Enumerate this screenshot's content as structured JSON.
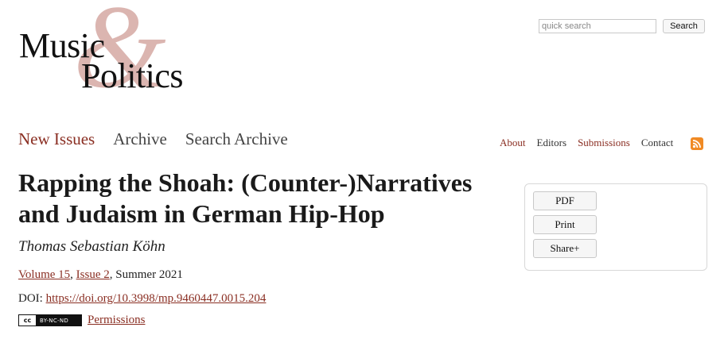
{
  "logo": {
    "word1": "Music",
    "ampersand": "&",
    "word2": "Politics"
  },
  "search": {
    "placeholder": "quick search",
    "button_label": "Search"
  },
  "main_nav": [
    {
      "label": "New Issues"
    },
    {
      "label": "Archive"
    },
    {
      "label": "Search Archive"
    }
  ],
  "sub_nav": [
    {
      "label": "About"
    },
    {
      "label": "Editors"
    },
    {
      "label": "Submissions"
    },
    {
      "label": "Contact"
    }
  ],
  "article": {
    "title_line1": "Rapping the Shoah: (Counter-)Narratives",
    "title_line2": "and Judaism in German Hip-Hop",
    "author": "Thomas Sebastian Köhn",
    "volume_link": "Volume 15",
    "issue_link": "Issue 2",
    "season": ", Summer 2021",
    "doi_label": "DOI: ",
    "doi_link": "https://doi.org/10.3998/mp.9460447.0015.204",
    "license_left": "cc",
    "license_right": "BY-NC-ND",
    "permissions_link": "Permissions"
  },
  "tools": {
    "pdf": "PDF",
    "print": "Print",
    "share": "Share+"
  },
  "colors": {
    "accent": "#8a2e22",
    "logo_ampersand": "#dbb5b0",
    "rss": "#f08a24"
  },
  "icons": {
    "rss": "rss-feed-icon",
    "license": "creative-commons-badge"
  }
}
